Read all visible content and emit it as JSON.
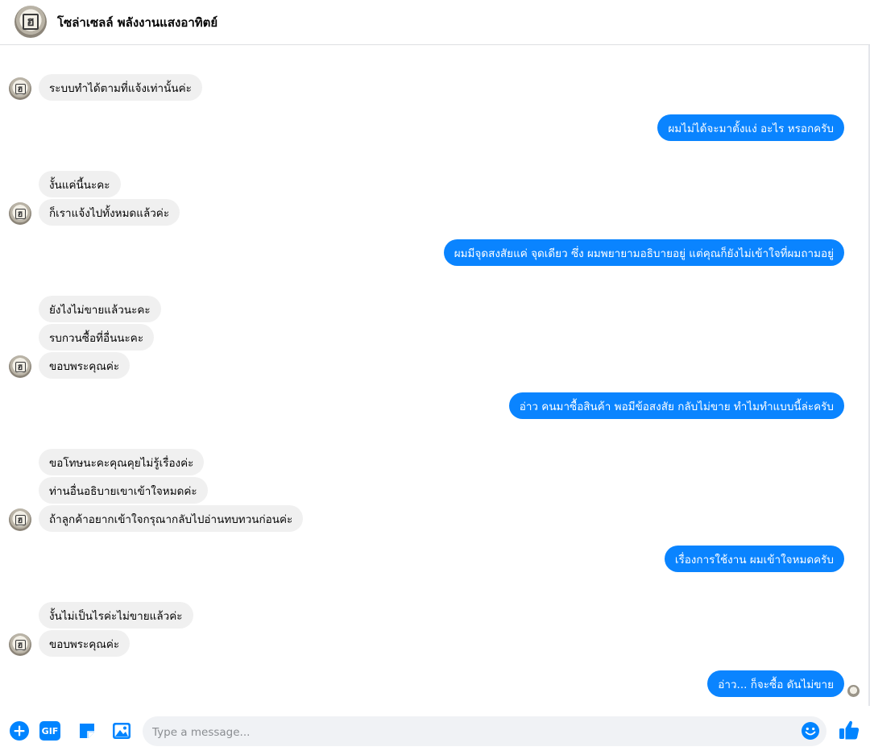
{
  "header": {
    "title": "โซล่าเซลล์ พลังงานแสงอาทิตย์",
    "avatar_icon": "store-logo-avatar"
  },
  "messages": [
    {
      "side": "in",
      "text": "ระบบทำได้ตามที่แจ้งเท่านั้นค่ะ"
    },
    {
      "side": "out",
      "text": "ผมไม่ได้จะมาตั้งแง่ อะไร หรอกครับ"
    },
    {
      "side": "in",
      "text": "งั้นแค่นี้นะคะ"
    },
    {
      "side": "in",
      "text": "ก็เราแจ้งไปทั้งหมดแล้วค่ะ"
    },
    {
      "side": "out",
      "text": "ผมมีจุดสงสัยแค่ จุดเดียว  ซึ่ง ผมพยายามอธิบายอยู่  แต่คุณก็ยังไม่เข้าใจที่ผมถามอยู่"
    },
    {
      "side": "in",
      "text": "ยังไงไม่ขายแล้วนะคะ"
    },
    {
      "side": "in",
      "text": "รบกวนซื้อที่อื่นนะคะ"
    },
    {
      "side": "in",
      "text": "ขอบพระคุณค่ะ"
    },
    {
      "side": "out",
      "text": "อ่าว  คนมาซื้อสินค้า  พอมีข้อสงสัย  กลับไม่ขาย  ทำไมทำแบบนี้ล่ะครับ"
    },
    {
      "side": "in",
      "text": "ขอโทษนะคะคุณคุยไม่รู้เรื่องค่ะ"
    },
    {
      "side": "in",
      "text": "ท่านอื่นอธิบายเขาเข้าใจหมดค่ะ"
    },
    {
      "side": "in",
      "text": "ถ้าลูกค้าอยากเข้าใจกรุณากลับไปอ่านทบทวนก่อนค่ะ"
    },
    {
      "side": "out",
      "text": "เรื่องการใช้งาน  ผมเข้าใจหมดครับ"
    },
    {
      "side": "in",
      "text": "งั้นไม่เป็นไรค่ะไม่ขายแล้วค่ะ"
    },
    {
      "side": "in",
      "text": "ขอบพระคุณค่ะ"
    },
    {
      "side": "out",
      "text": "อ่าว...  ก็จะซื้อ  ดันไม่ขาย"
    }
  ],
  "composer": {
    "placeholder": "Type a message...",
    "gif_label": "GIF",
    "icons": [
      "plus-icon",
      "gif-icon",
      "sticker-icon",
      "image-icon",
      "emoji-icon",
      "thumbs-up-icon"
    ]
  },
  "colors": {
    "outgoing_bubble": "#0a84ff",
    "incoming_bubble": "#f0f0f0",
    "accent": "#0084ff"
  }
}
